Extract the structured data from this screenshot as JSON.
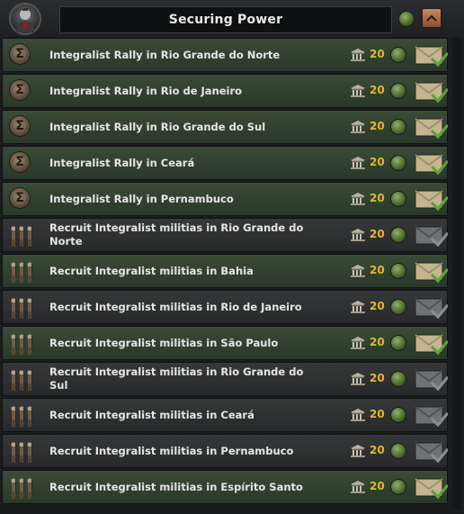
{
  "header": {
    "title": "Securing Power",
    "avatar_icon": "leader-portrait-icon",
    "status_icon": "green-status-icon",
    "collapse_icon": "chevron-up-icon"
  },
  "colors": {
    "available_row": "#3a4b36",
    "unavailable_row": "#363839",
    "cost": "#e0b732",
    "text": "#e6e6e6"
  },
  "decisions": [
    {
      "label": "Integralist Rally in Rio Grande do Norte",
      "cost": "20",
      "icon": "sigma-icon",
      "available": true
    },
    {
      "label": "Integralist Rally in Rio de Janeiro",
      "cost": "20",
      "icon": "sigma-icon",
      "available": true
    },
    {
      "label": "Integralist Rally in Rio Grande do Sul",
      "cost": "20",
      "icon": "sigma-icon",
      "available": true
    },
    {
      "label": "Integralist Rally in Ceará",
      "cost": "20",
      "icon": "sigma-icon",
      "available": true
    },
    {
      "label": "Integralist Rally in Pernambuco",
      "cost": "20",
      "icon": "sigma-icon",
      "available": true
    },
    {
      "label": "Recruit Integralist militias in Rio Grande do Norte",
      "cost": "20",
      "icon": "soldiers-icon",
      "available": false
    },
    {
      "label": "Recruit Integralist militias in Bahia",
      "cost": "20",
      "icon": "soldiers-icon",
      "available": true
    },
    {
      "label": "Recruit Integralist militias in Rio de Janeiro",
      "cost": "20",
      "icon": "soldiers-icon",
      "available": false
    },
    {
      "label": "Recruit Integralist militias in São Paulo",
      "cost": "20",
      "icon": "soldiers-icon",
      "available": true
    },
    {
      "label": "Recruit Integralist militias in Rio Grande do Sul",
      "cost": "20",
      "icon": "soldiers-icon",
      "available": false
    },
    {
      "label": "Recruit Integralist militias in Ceará",
      "cost": "20",
      "icon": "soldiers-icon",
      "available": false
    },
    {
      "label": "Recruit Integralist militias in Pernambuco",
      "cost": "20",
      "icon": "soldiers-icon",
      "available": false
    },
    {
      "label": "Recruit Integralist militias in Espírito Santo",
      "cost": "20",
      "icon": "soldiers-icon",
      "available": true
    }
  ]
}
